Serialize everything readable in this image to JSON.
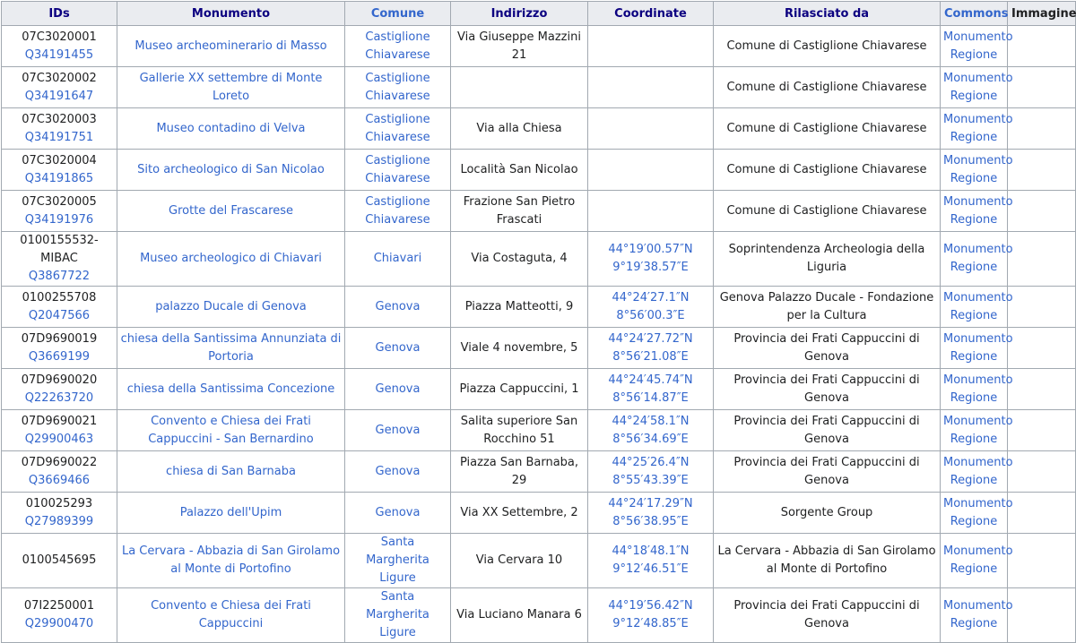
{
  "headers": [
    "IDs",
    "Monumento",
    "Comune",
    "Indirizzo",
    "Coordinate",
    "Rilasciato da",
    "Commons",
    "Immagine"
  ],
  "rows": [
    {
      "id": "07C3020001",
      "q": "Q34191455",
      "monumento": "Museo archeominerario di Masso",
      "comune": "Castiglione Chiavarese",
      "indirizzo": "Via Giuseppe Mazzini 21",
      "lat": "",
      "lon": "",
      "rilasciato": "Comune di Castiglione Chiavarese",
      "commons1": "Monumento",
      "commons2": "Regione"
    },
    {
      "id": "07C3020002",
      "q": "Q34191647",
      "monumento": "Gallerie XX settembre di Monte Loreto",
      "comune": "Castiglione Chiavarese",
      "indirizzo": "",
      "lat": "",
      "lon": "",
      "rilasciato": "Comune di Castiglione Chiavarese",
      "commons1": "Monumento",
      "commons2": "Regione"
    },
    {
      "id": "07C3020003",
      "q": "Q34191751",
      "monumento": "Museo contadino di Velva",
      "comune": "Castiglione Chiavarese",
      "indirizzo": "Via alla Chiesa",
      "lat": "",
      "lon": "",
      "rilasciato": "Comune di Castiglione Chiavarese",
      "commons1": "Monumento",
      "commons2": "Regione"
    },
    {
      "id": "07C3020004",
      "q": "Q34191865",
      "monumento": "Sito archeologico di San Nicolao",
      "comune": "Castiglione Chiavarese",
      "indirizzo": "Località San Nicolao",
      "lat": "",
      "lon": "",
      "rilasciato": "Comune di Castiglione Chiavarese",
      "commons1": "Monumento",
      "commons2": "Regione"
    },
    {
      "id": "07C3020005",
      "q": "Q34191976",
      "monumento": "Grotte del Frascarese",
      "comune": "Castiglione Chiavarese",
      "indirizzo": "Frazione San Pietro Frascati",
      "lat": "",
      "lon": "",
      "rilasciato": "Comune di Castiglione Chiavarese",
      "commons1": "Monumento",
      "commons2": "Regione"
    },
    {
      "id": "0100155532-MIBAC",
      "q": "Q3867722",
      "monumento": "Museo archeologico di Chiavari",
      "comune": "Chiavari",
      "indirizzo": "Via Costaguta, 4",
      "lat": "44°19′00.57″N",
      "lon": "9°19′38.57″E",
      "rilasciato": "Soprintendenza Archeologia della Liguria",
      "commons1": "Monumento",
      "commons2": "Regione"
    },
    {
      "id": "0100255708",
      "q": "Q2047566",
      "monumento": "palazzo Ducale di Genova",
      "comune": "Genova",
      "indirizzo": "Piazza Matteotti, 9",
      "lat": "44°24′27.1″N",
      "lon": "8°56′00.3″E",
      "rilasciato": "Genova Palazzo Ducale - Fondazione per la Cultura",
      "commons1": "Monumento",
      "commons2": "Regione"
    },
    {
      "id": "07D9690019",
      "q": "Q3669199",
      "monumento": "chiesa della Santissima Annunziata di Portoria",
      "comune": "Genova",
      "indirizzo": "Viale 4 novembre, 5",
      "lat": "44°24′27.72″N",
      "lon": "8°56′21.08″E",
      "rilasciato": "Provincia dei Frati Cappuccini di Genova",
      "commons1": "Monumento",
      "commons2": "Regione"
    },
    {
      "id": "07D9690020",
      "q": "Q22263720",
      "monumento": "chiesa della Santissima Concezione",
      "comune": "Genova",
      "indirizzo": "Piazza Cappuccini, 1",
      "lat": "44°24′45.74″N",
      "lon": "8°56′14.87″E",
      "rilasciato": "Provincia dei Frati Cappuccini di Genova",
      "commons1": "Monumento",
      "commons2": "Regione"
    },
    {
      "id": "07D9690021",
      "q": "Q29900463",
      "monumento": "Convento e Chiesa dei Frati Cappuccini - San Bernardino",
      "comune": "Genova",
      "indirizzo": "Salita superiore San Rocchino 51",
      "lat": "44°24′58.1″N",
      "lon": "8°56′34.69″E",
      "rilasciato": "Provincia dei Frati Cappuccini di Genova",
      "commons1": "Monumento",
      "commons2": "Regione"
    },
    {
      "id": "07D9690022",
      "q": "Q3669466",
      "monumento": "chiesa di San Barnaba",
      "comune": "Genova",
      "indirizzo": "Piazza San Barnaba, 29",
      "lat": "44°25′26.4″N",
      "lon": "8°55′43.39″E",
      "rilasciato": "Provincia dei Frati Cappuccini di Genova",
      "commons1": "Monumento",
      "commons2": "Regione"
    },
    {
      "id": "010025293",
      "q": "Q27989399",
      "monumento": "Palazzo dell'Upim",
      "comune": "Genova",
      "indirizzo": "Via XX Settembre, 2",
      "lat": "44°24′17.29″N",
      "lon": "8°56′38.95″E",
      "rilasciato": "Sorgente Group",
      "commons1": "Monumento",
      "commons2": "Regione"
    },
    {
      "id": "0100545695",
      "q": "",
      "monumento": "La Cervara - Abbazia di San Girolamo al Monte di Portofino",
      "comune": "Santa Margherita Ligure",
      "indirizzo": "Via Cervara 10",
      "lat": "44°18′48.1″N",
      "lon": "9°12′46.51″E",
      "rilasciato": "La Cervara - Abbazia di San Girolamo al Monte di Portofino",
      "commons1": "Monumento",
      "commons2": "Regione"
    },
    {
      "id": "07I2250001",
      "q": "Q29900470",
      "monumento": "Convento e Chiesa dei Frati Cappuccini",
      "comune": "Santa Margherita Ligure",
      "indirizzo": "Via Luciano Manara 6",
      "lat": "44°19′56.42″N",
      "lon": "9°12′48.85″E",
      "rilasciato": "Provincia dei Frati Cappuccini di Genova",
      "commons1": "Monumento",
      "commons2": "Regione"
    }
  ]
}
